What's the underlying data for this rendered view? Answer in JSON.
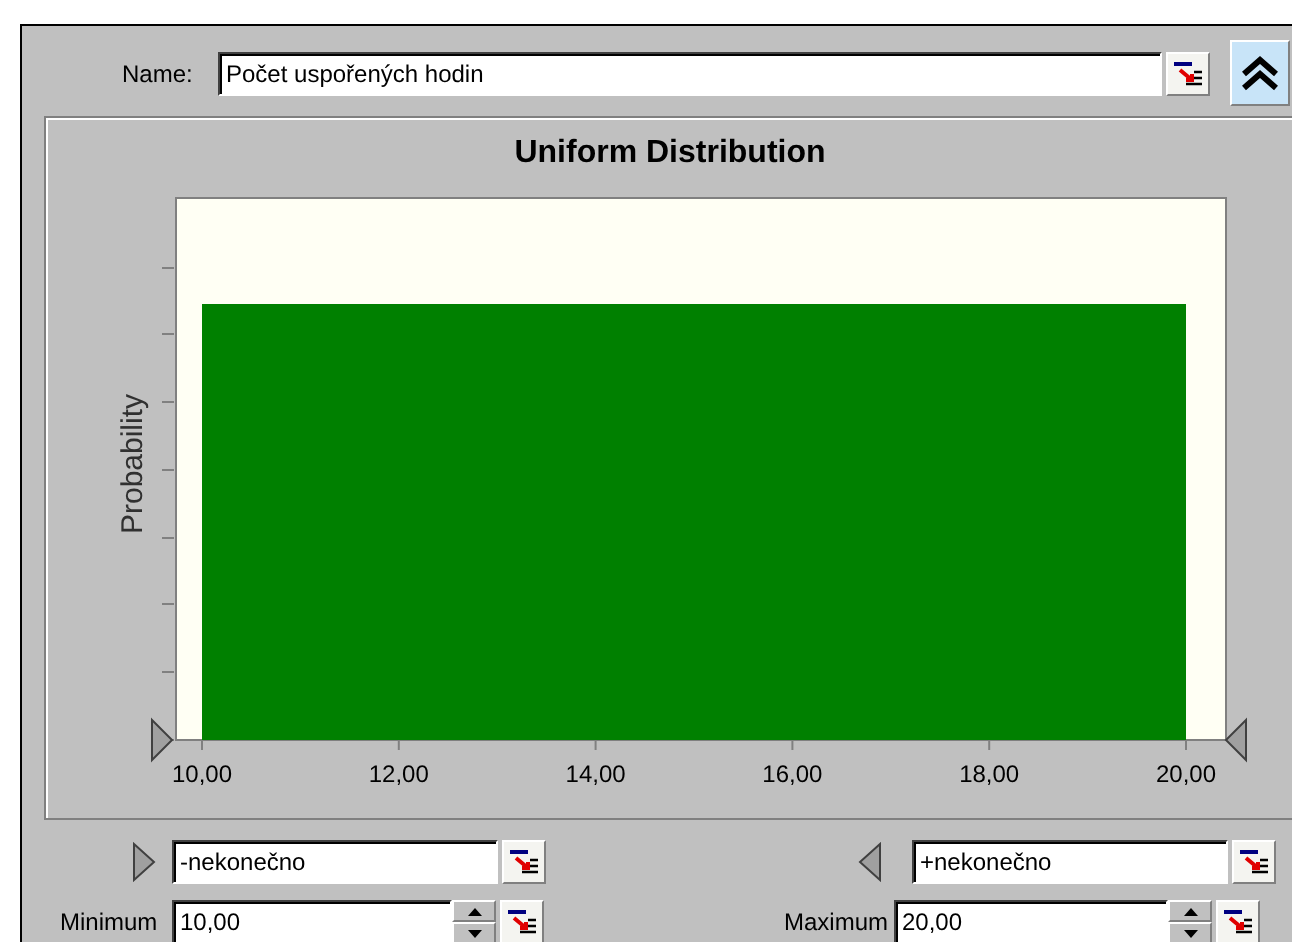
{
  "name_field": {
    "label": "Name:",
    "value": "Počet uspořených hodin"
  },
  "distribution_chart": {
    "title": "Uniform Distribution",
    "y_axis_label": "Probability",
    "x_tick_labels": [
      "10,00",
      "12,00",
      "14,00",
      "16,00",
      "18,00",
      "20,00"
    ]
  },
  "lower_bound": {
    "value": "-nekonečno"
  },
  "upper_bound": {
    "value": "+nekonečno"
  },
  "minimum": {
    "label": "Minimum",
    "value": "10,00"
  },
  "maximum": {
    "label": "Maximum",
    "value": "20,00"
  }
}
